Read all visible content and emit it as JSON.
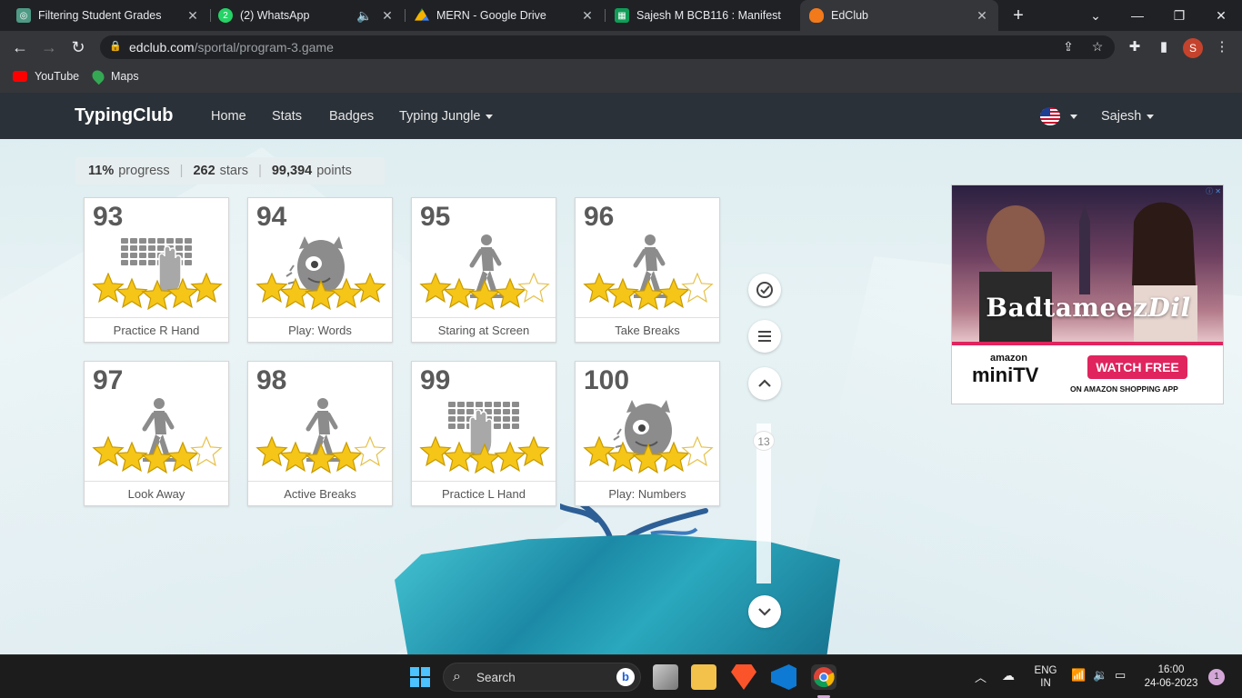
{
  "browser": {
    "tabs": [
      {
        "title": "Filtering Student Grades",
        "icon_color": "#4e9a84",
        "active": false
      },
      {
        "title": "(2) WhatsApp",
        "icon_color": "#25d366",
        "badge": "2",
        "active": false
      },
      {
        "title": "MERN - Google Drive",
        "icon_color": "#f4b400",
        "active": false
      },
      {
        "title": "Sajesh M BCB116 : Manifest",
        "icon_color": "#0f9d58",
        "active": false
      },
      {
        "title": "EdClub",
        "icon_color": "#f27a1a",
        "active": true
      }
    ],
    "url": "edclub.com",
    "url_path": "/sportal/program-3.game",
    "profile_initial": "S",
    "bookmarks": [
      {
        "label": "YouTube",
        "icon_color": "#ff0000"
      },
      {
        "label": "Maps",
        "icon_color": "#34a853"
      }
    ]
  },
  "site": {
    "brand": "TypingClub",
    "nav": {
      "home": "Home",
      "stats": "Stats",
      "badges": "Badges",
      "typing_jungle": "Typing Jungle",
      "user": "Sajesh"
    },
    "stats": {
      "progress_value": "11%",
      "progress_label": "progress",
      "stars_value": "262",
      "stars_label": "stars",
      "points_value": "99,394",
      "points_label": "points"
    },
    "lessons": [
      {
        "num": "93",
        "label": "Practice R Hand",
        "stars": 5,
        "illustration": "keyboard-right-hand-icon"
      },
      {
        "num": "94",
        "label": "Play: Words",
        "stars": 5,
        "illustration": "monster-icon"
      },
      {
        "num": "95",
        "label": "Staring at Screen",
        "stars": 4,
        "illustration": "walking-person-icon"
      },
      {
        "num": "96",
        "label": "Take Breaks",
        "stars": 4,
        "illustration": "walking-person-icon"
      },
      {
        "num": "97",
        "label": "Look Away",
        "stars": 4,
        "illustration": "walking-person-icon"
      },
      {
        "num": "98",
        "label": "Active Breaks",
        "stars": 4,
        "illustration": "walking-person-icon"
      },
      {
        "num": "99",
        "label": "Practice L Hand",
        "stars": 5,
        "illustration": "keyboard-left-hand-icon"
      },
      {
        "num": "100",
        "label": "Play: Numbers",
        "stars": 4,
        "illustration": "monster-icon"
      }
    ],
    "scroll_indicator": "13",
    "ad": {
      "title_main": "Badtameez",
      "title_script": "Dil",
      "amazon": "amazon",
      "minitv": "miniTV",
      "cta": "WATCH FREE",
      "sub": "ON AMAZON SHOPPING APP"
    }
  },
  "taskbar": {
    "search_placeholder": "Search",
    "lang_top": "ENG",
    "lang_bottom": "IN",
    "time": "16:00",
    "date": "24-06-2023",
    "notification_count": "1"
  },
  "colors": {
    "header_bg": "#2a3138",
    "star_fill": "#f5c518",
    "star_stroke": "#c79a00"
  }
}
